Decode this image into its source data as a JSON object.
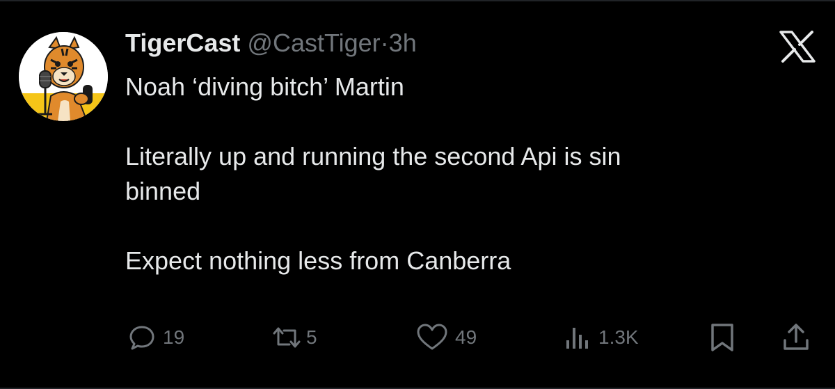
{
  "tweet": {
    "author_name": "TigerCast",
    "author_handle": "@CastTiger",
    "separator": "·",
    "time": "3h",
    "paragraphs": [
      "Noah ‘diving bitch’ Martin",
      "Literally up and running the second Api is sin",
      "binned",
      "Expect nothing less from Canberra"
    ]
  },
  "actions": {
    "replies": "19",
    "retweets": "5",
    "likes": "49",
    "views": "1.3K"
  },
  "icons": {
    "reply": "reply-icon",
    "retweet": "retweet-icon",
    "like": "heart-icon",
    "views": "views-icon",
    "bookmark": "bookmark-icon",
    "share": "share-icon",
    "logo": "x-logo-icon"
  },
  "colors": {
    "background": "#000000",
    "text": "#e7e9ea",
    "muted": "#71767b",
    "avatar_yellow": "#f5c518"
  }
}
